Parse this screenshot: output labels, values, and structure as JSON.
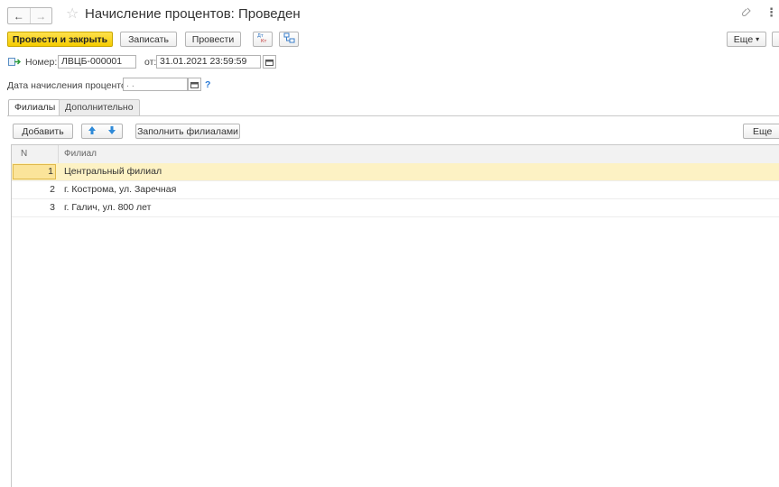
{
  "window": {
    "title": "Начисление процентов: Проведен"
  },
  "toolbar": {
    "post_close_label": "Провести и закрыть",
    "save_label": "Записать",
    "post_label": "Провести",
    "more_label": "Еще",
    "more_arrow": "▾"
  },
  "header": {
    "number_label": "Номер:",
    "number_value": "ЛВЦБ-000001",
    "date_label": "от:",
    "date_value": "31.01.2021 23:59:59",
    "interest_date_label": "Дата начисления процентов:",
    "interest_date_value": " .  .",
    "help_mark": "?"
  },
  "tabs": [
    {
      "label": "Филиалы",
      "active": true
    },
    {
      "label": "Дополнительно",
      "active": false
    }
  ],
  "table_toolbar": {
    "add_label": "Добавить",
    "fill_label": "Заполнить филиалами",
    "more_label": "Еще"
  },
  "table": {
    "columns": [
      "N",
      "Филиал"
    ],
    "rows": [
      {
        "n": "1",
        "branch": "Центральный филиал"
      },
      {
        "n": "2",
        "branch": "г. Кострома, ул. Заречная"
      },
      {
        "n": "3",
        "branch": "г. Галич, ул. 800 лет"
      }
    ],
    "selected_row": 0
  },
  "colors": {
    "primary_button": "#f5cc00",
    "selected_row": "#fdf2c4",
    "current_cell": "#fbe49a",
    "help_mark": "#2a7ad6",
    "arrow_icon": "#2f8ad8"
  },
  "icons": [
    "back-arrow-icon",
    "forward-arrow-icon",
    "favorite-star-icon",
    "link-icon",
    "more-vertical-icon",
    "dt-kt-icon",
    "structure-icon",
    "document-post-icon",
    "calendar-icon",
    "move-up-icon",
    "move-down-icon"
  ]
}
